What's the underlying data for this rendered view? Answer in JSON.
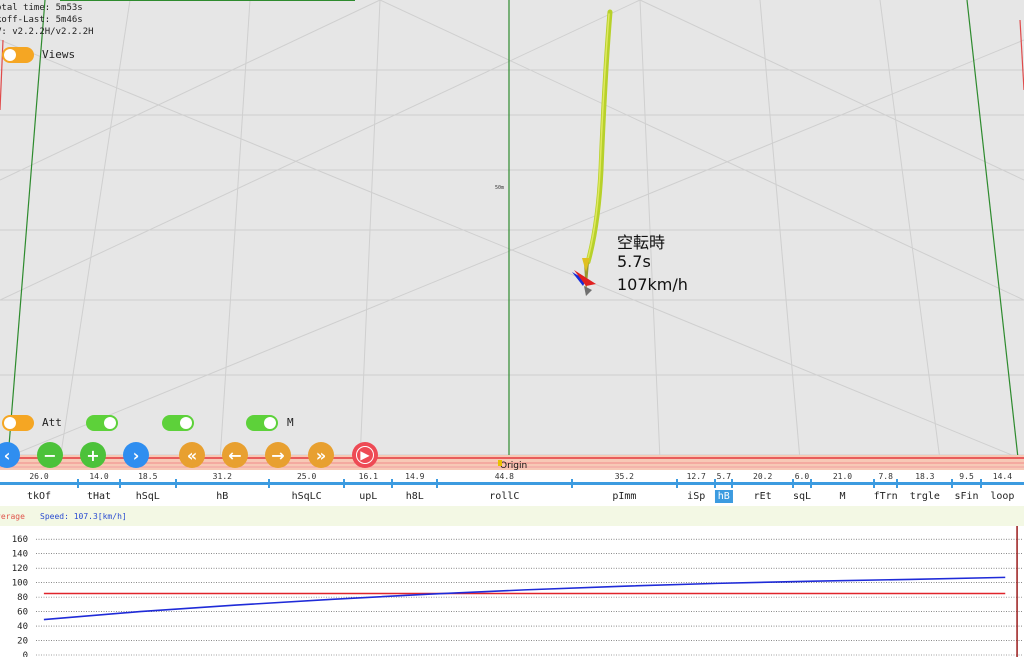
{
  "info": {
    "total_time": "otal time: 5m53s",
    "takeoff_last": "koff-Last: 5m46s",
    "version": "V: v2.2.2H/v2.2.2H"
  },
  "toggles": {
    "views_label": "Views",
    "att_label": "Att",
    "m_label": "M"
  },
  "scene": {
    "grid_label": "50m",
    "origin_label": "Origin",
    "overlay": {
      "state": "空転時",
      "time": "5.7s",
      "speed": "107km/h"
    }
  },
  "controls": {
    "left_icon": "chevron-left-icon",
    "minus_icon": "minus-icon",
    "plus_icon": "plus-icon",
    "right_icon": "chevron-right-icon",
    "rewind_icon": "double-chevron-left-icon",
    "back_icon": "arrow-left-icon",
    "forward_icon": "arrow-right-icon",
    "fastforward_icon": "double-chevron-right-icon",
    "play_icon": "play-circle-icon"
  },
  "colors": {
    "accent_blue": "#3c9be0",
    "toggle_off": "#f5a623",
    "toggle_on": "#5dd13a",
    "average_line": "#e0252c",
    "speed_line": "#1f2bd8"
  },
  "sequence": {
    "selected_index": 11,
    "segments": [
      {
        "label": "tkOf",
        "duration": "26.0"
      },
      {
        "label": "tHat",
        "duration": "14.0"
      },
      {
        "label": "hSqL",
        "duration": "18.5"
      },
      {
        "label": "hB",
        "duration": "31.2"
      },
      {
        "label": "hSqLC",
        "duration": "25.0"
      },
      {
        "label": "upL",
        "duration": "16.1"
      },
      {
        "label": "h8L",
        "duration": "14.9"
      },
      {
        "label": "rollC",
        "duration": "44.8"
      },
      {
        "label": "pImm",
        "duration": "35.2"
      },
      {
        "label": "iSp",
        "duration": "12.7"
      },
      {
        "label": "hB",
        "duration": "5.7"
      },
      {
        "label": "rEt",
        "duration": "20.2"
      },
      {
        "label": "sqL",
        "duration": "6.0"
      },
      {
        "label": "M",
        "duration": "21.0"
      },
      {
        "label": "fTrn",
        "duration": "7.8"
      },
      {
        "label": "trgle",
        "duration": "18.3"
      },
      {
        "label": "sFin",
        "duration": "9.5"
      },
      {
        "label": "loop",
        "duration": "14.4"
      }
    ]
  },
  "legend": {
    "average_label": "verage",
    "speed_label": "Speed: 107.3[km/h]"
  },
  "chart_data": {
    "type": "line",
    "yticks": [
      0,
      20,
      40,
      60,
      80,
      100,
      120,
      140,
      160
    ],
    "ylim": [
      0,
      170
    ],
    "xlim": [
      0,
      1
    ],
    "series": [
      {
        "name": "verage",
        "x": [
          0,
          1
        ],
        "values": [
          85,
          85
        ]
      },
      {
        "name": "Speed: 107.3[km/h]",
        "x": [
          0,
          0.1,
          0.2,
          0.3,
          0.4,
          0.5,
          0.6,
          0.7,
          0.8,
          0.9,
          1.0
        ],
        "values": [
          49,
          60,
          69,
          77,
          84,
          90,
          95,
          99,
          102,
          104.5,
          107.3
        ]
      }
    ],
    "cursor_x": 0.995
  }
}
